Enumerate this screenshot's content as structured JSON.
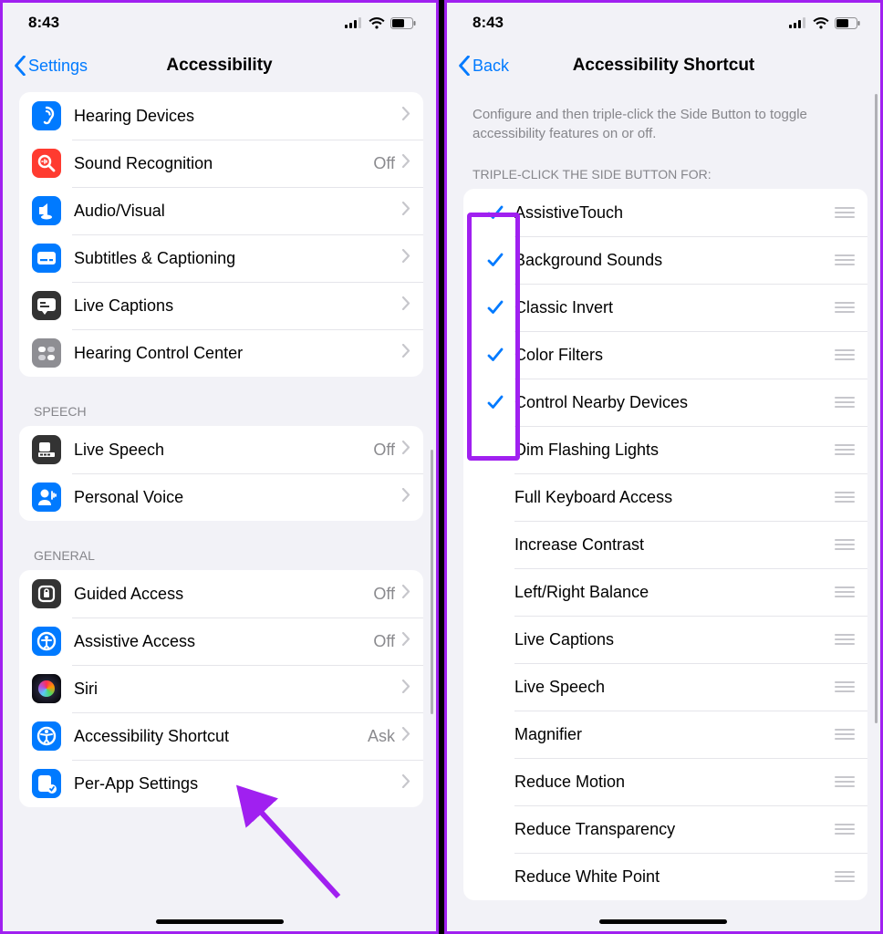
{
  "left": {
    "status_time": "8:43",
    "nav_back": "Settings",
    "nav_title": "Accessibility",
    "groups": [
      {
        "header": "",
        "rows": [
          {
            "icon": "hearing",
            "label": "Hearing Devices",
            "detail": ""
          },
          {
            "icon": "sound-recognition",
            "label": "Sound Recognition",
            "detail": "Off"
          },
          {
            "icon": "audio-visual",
            "label": "Audio/Visual",
            "detail": ""
          },
          {
            "icon": "subtitles",
            "label": "Subtitles & Captioning",
            "detail": ""
          },
          {
            "icon": "live-captions",
            "label": "Live Captions",
            "detail": ""
          },
          {
            "icon": "hearing-control",
            "label": "Hearing Control Center",
            "detail": ""
          }
        ]
      },
      {
        "header": "SPEECH",
        "rows": [
          {
            "icon": "live-speech",
            "label": "Live Speech",
            "detail": "Off"
          },
          {
            "icon": "personal-voice",
            "label": "Personal Voice",
            "detail": ""
          }
        ]
      },
      {
        "header": "GENERAL",
        "rows": [
          {
            "icon": "guided-access",
            "label": "Guided Access",
            "detail": "Off"
          },
          {
            "icon": "assistive-access",
            "label": "Assistive Access",
            "detail": "Off"
          },
          {
            "icon": "siri",
            "label": "Siri",
            "detail": ""
          },
          {
            "icon": "accessibility-shortcut",
            "label": "Accessibility Shortcut",
            "detail": "Ask"
          },
          {
            "icon": "per-app-settings",
            "label": "Per-App Settings",
            "detail": ""
          }
        ]
      }
    ]
  },
  "right": {
    "status_time": "8:43",
    "nav_back": "Back",
    "nav_title": "Accessibility Shortcut",
    "description": "Configure and then triple-click the Side Button to toggle accessibility features on or off.",
    "list_header": "TRIPLE-CLICK THE SIDE BUTTON FOR:",
    "items": [
      {
        "checked": true,
        "label": "AssistiveTouch"
      },
      {
        "checked": true,
        "label": "Background Sounds"
      },
      {
        "checked": true,
        "label": "Classic Invert"
      },
      {
        "checked": true,
        "label": "Color Filters"
      },
      {
        "checked": true,
        "label": "Control Nearby Devices"
      },
      {
        "checked": false,
        "label": "Dim Flashing Lights"
      },
      {
        "checked": false,
        "label": "Full Keyboard Access"
      },
      {
        "checked": false,
        "label": "Increase Contrast"
      },
      {
        "checked": false,
        "label": "Left/Right Balance"
      },
      {
        "checked": false,
        "label": "Live Captions"
      },
      {
        "checked": false,
        "label": "Live Speech"
      },
      {
        "checked": false,
        "label": "Magnifier"
      },
      {
        "checked": false,
        "label": "Reduce Motion"
      },
      {
        "checked": false,
        "label": "Reduce Transparency"
      },
      {
        "checked": false,
        "label": "Reduce White Point"
      }
    ]
  },
  "icon_colors": {
    "hearing": "#007aff",
    "sound-recognition": "#ff3b30",
    "audio-visual": "#007aff",
    "subtitles": "#007aff",
    "live-captions": "#333333",
    "hearing-control": "#8e8e93",
    "live-speech": "#333333",
    "personal-voice": "#007aff",
    "guided-access": "#333333",
    "assistive-access": "#007aff",
    "siri": "siri",
    "accessibility-shortcut": "#007aff",
    "per-app-settings": "#007aff"
  }
}
